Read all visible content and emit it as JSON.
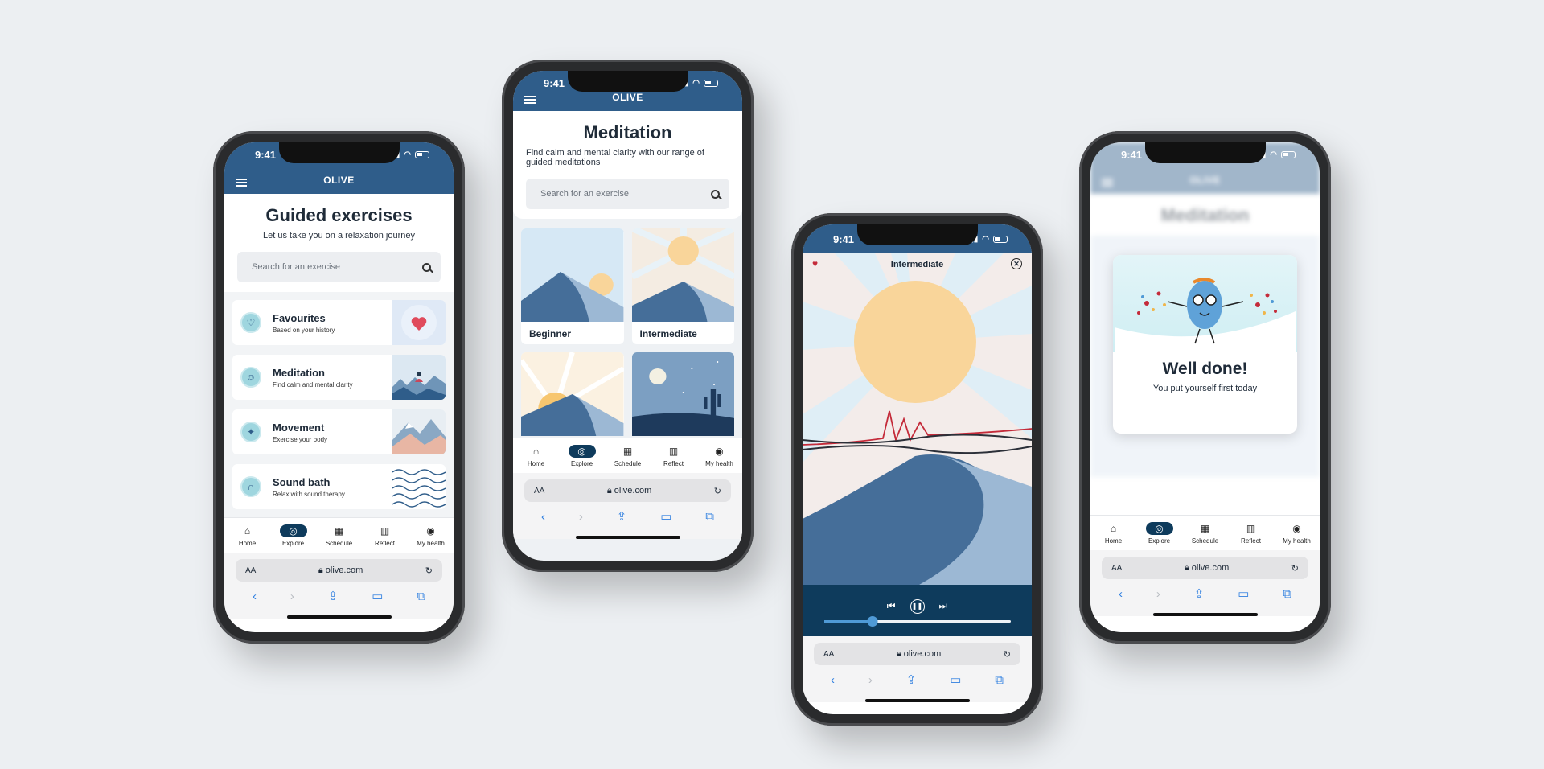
{
  "common": {
    "time": "9:41",
    "brand": "OLIVE",
    "url": "olive.com",
    "aa_label": "AA",
    "tabs": [
      "Home",
      "Explore",
      "Schedule",
      "Reflect",
      "My health"
    ]
  },
  "screen1": {
    "title": "Guided exercises",
    "subtitle": "Let us take you on a relaxation journey",
    "search_placeholder": "Search for an exercise",
    "cards": [
      {
        "title": "Favourites",
        "sub": "Based on your history"
      },
      {
        "title": "Meditation",
        "sub": "Find calm and mental clarity"
      },
      {
        "title": "Movement",
        "sub": "Exercise your body"
      },
      {
        "title": "Sound bath",
        "sub": "Relax with sound therapy"
      }
    ]
  },
  "screen2": {
    "title": "Meditation",
    "subtitle": "Find calm and mental clarity with our range of guided meditations",
    "search_placeholder": "Search for an exercise",
    "tiles": [
      "Beginner",
      "Intermediate"
    ]
  },
  "screen3": {
    "title": "Intermediate",
    "progress": 0.26
  },
  "screen4": {
    "title": "Well done!",
    "subtitle": "You put yourself first today",
    "bg_title": "Meditation"
  },
  "colors": {
    "brand": "#2f5d8a",
    "dark": "#0e3b5c",
    "sun": "#f9d59a",
    "mountain": "#456e99",
    "accent": "#c42b3a"
  }
}
